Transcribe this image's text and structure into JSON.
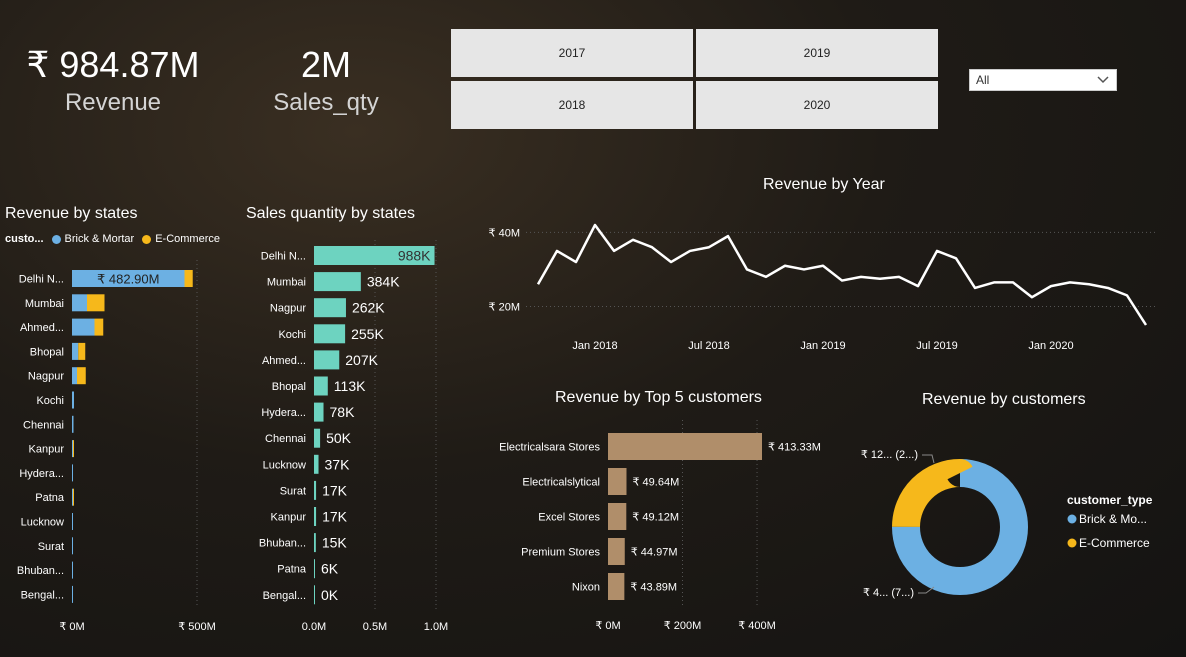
{
  "kpis": {
    "revenue_value": "₹ 984.87M",
    "revenue_label": "Revenue",
    "sales_value": "2M",
    "sales_label": "Sales_qty"
  },
  "year_slicer": [
    "2017",
    "2019",
    "2018",
    "2020"
  ],
  "dropdown": {
    "value": "All"
  },
  "chart_data": [
    {
      "type": "bar",
      "title": "Revenue by states",
      "legend_title": "custo...",
      "legend_position": "top",
      "series": [
        {
          "name": "Brick & Mortar",
          "values": [
            450,
            60,
            90,
            25,
            20,
            8,
            6,
            4,
            3,
            2,
            1.5,
            1.2,
            0.8,
            0.5
          ]
        },
        {
          "name": "E-Commerce",
          "values": [
            32.9,
            70,
            35,
            28,
            35,
            0,
            0,
            3,
            0,
            2,
            0,
            0,
            0,
            0
          ]
        }
      ],
      "categories": [
        "Delhi N...",
        "Mumbai",
        "Ahmed...",
        "Bhopal",
        "Nagpur",
        "Kochi",
        "Chennai",
        "Kanpur",
        "Hydera...",
        "Patna",
        "Lucknow",
        "Surat",
        "Bhuban...",
        "Bengal..."
      ],
      "data_label": "₹ 482.90M",
      "xticks": [
        "₹ 0M",
        "₹ 500M"
      ],
      "xlim": [
        0,
        560
      ],
      "colors": {
        "Brick & Mortar": "#6cb0e3",
        "E-Commerce": "#f6b81b"
      }
    },
    {
      "type": "bar",
      "title": "Sales quantity by states",
      "categories": [
        "Delhi N...",
        "Mumbai",
        "Nagpur",
        "Kochi",
        "Ahmed...",
        "Bhopal",
        "Hydera...",
        "Chennai",
        "Lucknow",
        "Surat",
        "Kanpur",
        "Bhuban...",
        "Patna",
        "Bengal..."
      ],
      "values": [
        988,
        384,
        262,
        255,
        207,
        113,
        78,
        50,
        37,
        17,
        17,
        15,
        6,
        0
      ],
      "labels": [
        "988K",
        "384K",
        "262K",
        "255K",
        "207K",
        "113K",
        "78K",
        "50K",
        "37K",
        "17K",
        "17K",
        "15K",
        "6K",
        "0K"
      ],
      "xticks": [
        "0.0M",
        "0.5M",
        "1.0M"
      ],
      "xlim": [
        0,
        1000
      ],
      "color": "#6dd3c0"
    },
    {
      "type": "line",
      "title": "Revenue by Year",
      "x": [
        "2017-10",
        "2017-11",
        "2017-12",
        "2018-01",
        "2018-02",
        "2018-03",
        "2018-04",
        "2018-05",
        "2018-06",
        "2018-07",
        "2018-08",
        "2018-09",
        "2018-10",
        "2018-11",
        "2018-12",
        "2019-01",
        "2019-02",
        "2019-03",
        "2019-04",
        "2019-05",
        "2019-06",
        "2019-07",
        "2019-08",
        "2019-09",
        "2019-10",
        "2019-11",
        "2019-12",
        "2020-01",
        "2020-02",
        "2020-03",
        "2020-04",
        "2020-05",
        "2020-06"
      ],
      "y": [
        26,
        35,
        32,
        42,
        35,
        38,
        36,
        32,
        35,
        36,
        39,
        30,
        28,
        31,
        30,
        31,
        27,
        28,
        27.5,
        28,
        25.5,
        35,
        33,
        25,
        26.5,
        26.5,
        22.5,
        25.5,
        26.5,
        26,
        25,
        23,
        15
      ],
      "yticks": [
        "₹ 40M",
        "₹ 20M"
      ],
      "xticks": [
        "Jan 2018",
        "Jul 2018",
        "Jan 2019",
        "Jul 2019",
        "Jan 2020"
      ],
      "ylim": [
        15,
        42
      ],
      "color": "#ffffff"
    },
    {
      "type": "bar",
      "title": "Revenue by Top 5 customers",
      "categories": [
        "Electricalsara Stores",
        "Electricalslytical",
        "Excel Stores",
        "Premium Stores",
        "Nixon"
      ],
      "values": [
        413.33,
        49.64,
        49.12,
        44.97,
        43.89
      ],
      "labels": [
        "₹ 413.33M",
        "₹ 49.64M",
        "₹ 49.12M",
        "₹ 44.97M",
        "₹ 43.89M"
      ],
      "xticks": [
        "₹ 0M",
        "₹ 200M",
        "₹ 400M"
      ],
      "xlim": [
        0,
        413.33
      ],
      "color": "#b08e6a"
    },
    {
      "type": "pie",
      "title": "Revenue by customers",
      "legend_title": "customer_type",
      "legend_position": "right",
      "series": [
        {
          "name": "Brick & Mo...",
          "value": 75
        },
        {
          "name": "E-Commerce",
          "value": 25
        }
      ],
      "labels": [
        "₹ 4... (7...)",
        "₹ 12... (2...)"
      ],
      "colors": {
        "Brick & Mortar": "#6cb0e3",
        "E-Commerce": "#f6b81b"
      }
    }
  ]
}
